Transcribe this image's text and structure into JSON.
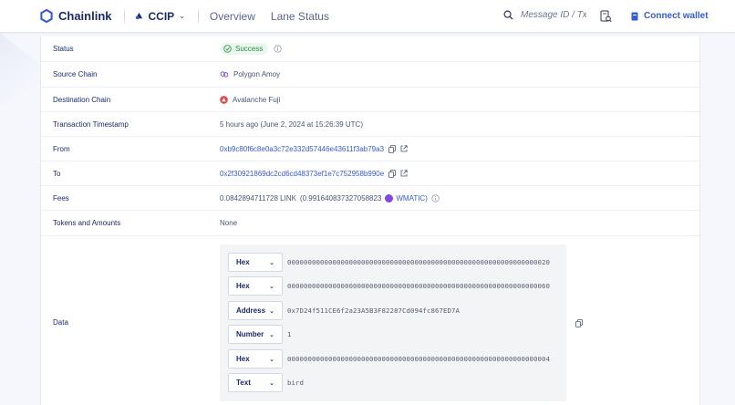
{
  "header": {
    "brand": "Chainlink",
    "product": "CCIP",
    "nav": [
      "Overview",
      "Lane Status"
    ],
    "search_placeholder": "Message ID / Txn...",
    "connect_label": "Connect wallet"
  },
  "rows": {
    "status": {
      "label": "Status",
      "value": "Success"
    },
    "source_chain": {
      "label": "Source Chain",
      "value": "Polygon Amoy"
    },
    "destination_chain": {
      "label": "Destination Chain",
      "value": "Avalanche Fuji"
    },
    "timestamp": {
      "label": "Transaction Timestamp",
      "value": "5 hours ago (June 2, 2024 at 15:26:39 UTC)"
    },
    "from": {
      "label": "From",
      "value": "0xb9c80f6c8e0a3c72e332d57446e43611f3ab79a3"
    },
    "to": {
      "label": "To",
      "value": "0x2f30921869dc2cd6cd48373ef1e7c752958b990e"
    },
    "fees": {
      "label": "Fees",
      "amount": "0.0842894711728 LINK",
      "alt_amount": "(0.991640837327058823",
      "token": "WMATIC)"
    },
    "tokens": {
      "label": "Tokens and Amounts",
      "value": "None"
    },
    "data": {
      "label": "Data"
    }
  },
  "data_items": [
    {
      "type": "Hex",
      "value": "0000000000000000000000000000000000000000000000000000000000000020"
    },
    {
      "type": "Hex",
      "value": "0000000000000000000000000000000000000000000000000000000000000060"
    },
    {
      "type": "Address",
      "value": "0x7D24f511CE6f2a23A5B3F82287Cd094fc867ED7A"
    },
    {
      "type": "Number",
      "value": "1"
    },
    {
      "type": "Hex",
      "value": "0000000000000000000000000000000000000000000000000000000000000004"
    },
    {
      "type": "Text",
      "value": "bird"
    }
  ],
  "colors": {
    "accent": "#375bd2",
    "success": "#2a8a3f",
    "polygon": "#8247e5",
    "avalanche": "#e84142"
  }
}
